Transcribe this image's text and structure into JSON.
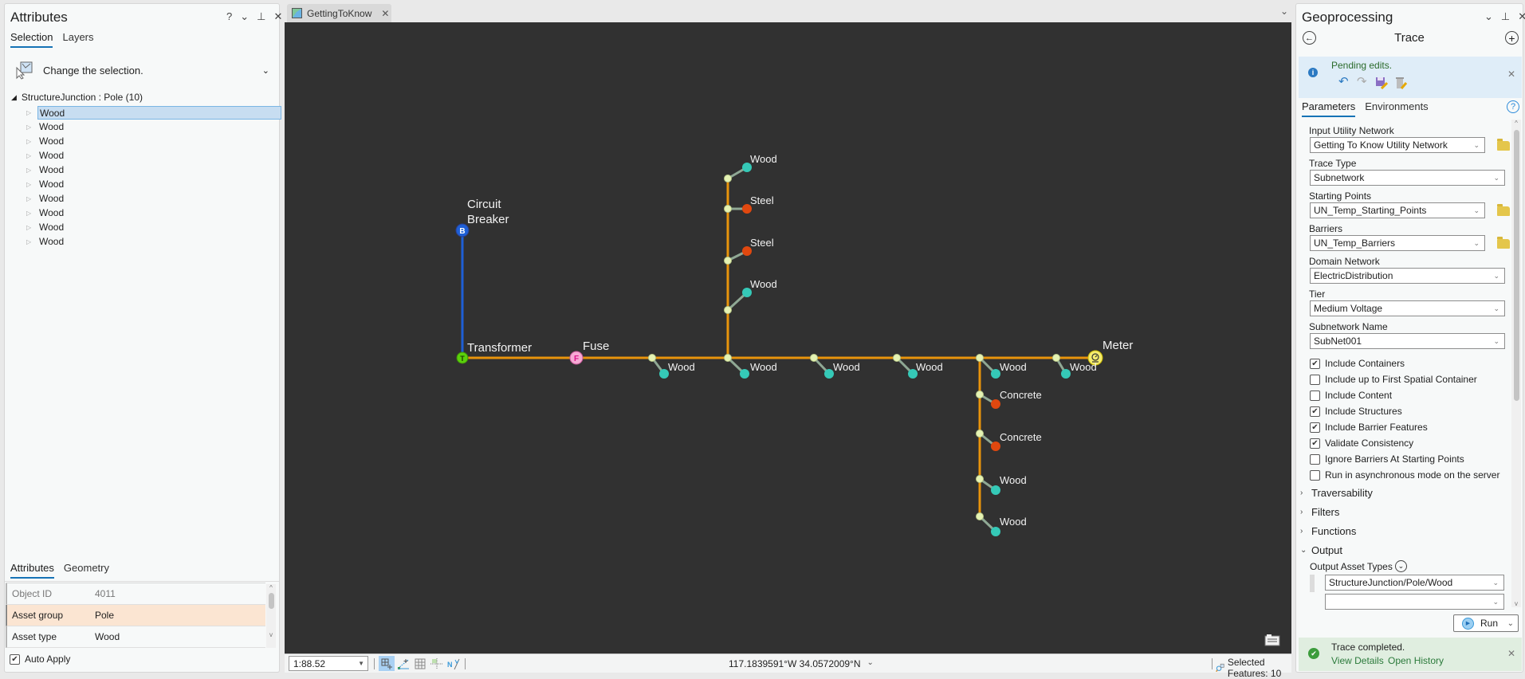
{
  "attributes_pane": {
    "title": "Attributes",
    "controls": {
      "help": "?",
      "menu": "⌄",
      "pin": "⊥",
      "close": "✕"
    },
    "tabs": [
      {
        "label": "Selection",
        "active": true
      },
      {
        "label": "Layers",
        "active": false
      }
    ],
    "change_selection_label": "Change the selection.",
    "tree": {
      "root_label": "StructureJunction : Pole (10)",
      "items": [
        "Wood",
        "Wood",
        "Wood",
        "Wood",
        "Wood",
        "Wood",
        "Wood",
        "Wood",
        "Wood",
        "Wood"
      ],
      "selected_index": 0
    },
    "detail_tabs": [
      {
        "label": "Attributes",
        "active": true
      },
      {
        "label": "Geometry",
        "active": false
      }
    ],
    "fields": [
      {
        "key": "Object ID",
        "value": "4011",
        "readonly": true
      },
      {
        "key": "Asset group",
        "value": "Pole",
        "highlighted": true
      },
      {
        "key": "Asset type",
        "value": "Wood"
      }
    ],
    "auto_apply": {
      "label": "Auto Apply",
      "checked": true
    }
  },
  "map_view": {
    "tab_label": "GettingToKnow",
    "labels": {
      "circuit_breaker_1": "Circuit",
      "circuit_breaker_2": "Breaker",
      "transformer": "Transformer",
      "fuse": "Fuse",
      "meter": "Meter"
    },
    "device_glyphs": {
      "breaker": "B",
      "transformer": "T",
      "fuse": "F"
    },
    "pole_labels": {
      "v1": "Wood",
      "v2": "Steel",
      "v3": "Steel",
      "v4": "Wood",
      "h1": "Wood",
      "h2": "Wood",
      "h3": "Wood",
      "h4": "Wood",
      "h5": "Wood",
      "h6": "Wood",
      "d1": "Concrete",
      "d2": "Concrete",
      "d3": "Wood",
      "d4": "Wood"
    },
    "colors": {
      "background": "#313131",
      "medium_voltage_line": "#e8940c",
      "breaker_line": "#1e5fd6",
      "wood_pole": "#35c9b7",
      "steel_concrete_pole": "#e0480f",
      "junction": "#e5f3b4",
      "guy": "#8fa894",
      "meter": "#f4ec6e",
      "fuse": "#f7a9d5",
      "transformer": "#5ad10b",
      "breaker": "#1e5fd6"
    }
  },
  "status_bar": {
    "scale": "1:88.52",
    "coordinates": "117.1839591°W 34.0572009°N",
    "selected_features": "Selected Features: 10"
  },
  "geoprocessing": {
    "title": "Geoprocessing",
    "tool_name": "Trace",
    "pending_edits": "Pending edits.",
    "tabs": [
      {
        "label": "Parameters",
        "active": true
      },
      {
        "label": "Environments",
        "active": false
      }
    ],
    "params": [
      {
        "label": "Input Utility Network",
        "value": "Getting To Know Utility Network",
        "browse": true
      },
      {
        "label": "Trace Type",
        "value": "Subnetwork",
        "browse": false
      },
      {
        "label": "Starting Points",
        "value": "UN_Temp_Starting_Points",
        "browse": true
      },
      {
        "label": "Barriers",
        "value": "UN_Temp_Barriers",
        "browse": true
      },
      {
        "label": "Domain Network",
        "value": "ElectricDistribution",
        "browse": false
      },
      {
        "label": "Tier",
        "value": "Medium Voltage",
        "browse": false
      },
      {
        "label": "Subnetwork Name",
        "value": "SubNet001",
        "browse": false
      }
    ],
    "checkboxes": [
      {
        "label": "Include Containers",
        "checked": true
      },
      {
        "label": "Include up to First Spatial Container",
        "checked": false
      },
      {
        "label": "Include Content",
        "checked": false
      },
      {
        "label": "Include Structures",
        "checked": true
      },
      {
        "label": "Include Barrier Features",
        "checked": true
      },
      {
        "label": "Validate Consistency",
        "checked": true
      },
      {
        "label": "Ignore Barriers At Starting Points",
        "checked": false
      },
      {
        "label": "Run in asynchronous mode on the server",
        "checked": false
      }
    ],
    "sections": [
      {
        "label": "Traversability",
        "expanded": false
      },
      {
        "label": "Filters",
        "expanded": false
      },
      {
        "label": "Functions",
        "expanded": false
      },
      {
        "label": "Output",
        "expanded": true
      }
    ],
    "output_asset_types_label": "Output Asset Types",
    "output_asset_types": [
      "StructureJunction/Pole/Wood",
      ""
    ],
    "run_label": "Run",
    "message": {
      "text": "Trace completed.",
      "view_details": "View Details",
      "open_history": "Open History"
    }
  }
}
